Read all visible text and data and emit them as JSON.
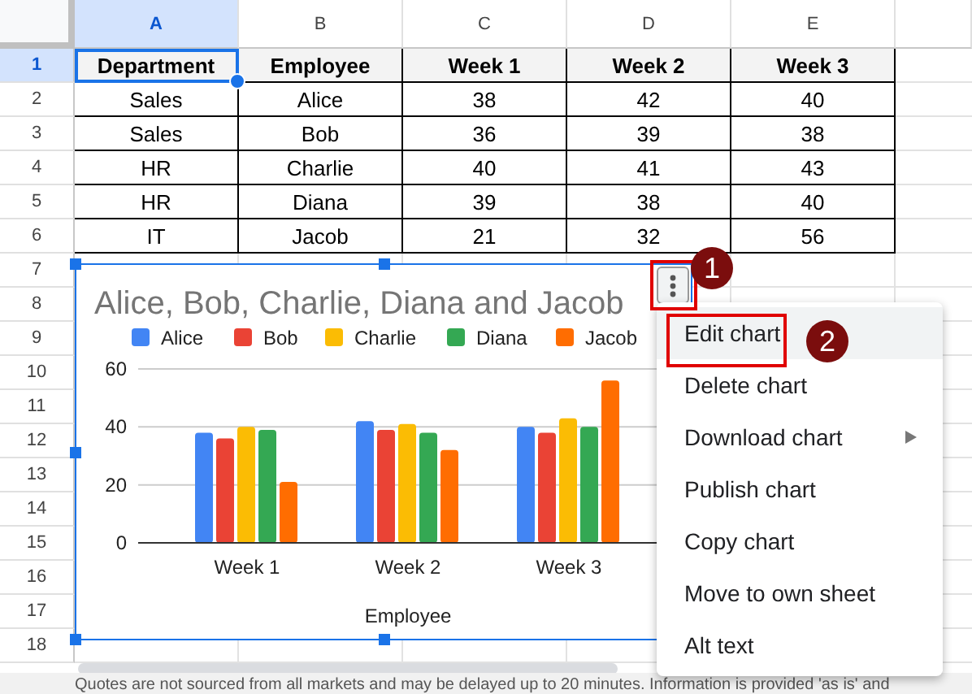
{
  "columns": [
    {
      "label": "A",
      "selected": true
    },
    {
      "label": "B",
      "selected": false
    },
    {
      "label": "C",
      "selected": false
    },
    {
      "label": "D",
      "selected": false
    },
    {
      "label": "E",
      "selected": false
    }
  ],
  "row_numbers": [
    {
      "label": "1",
      "selected": true
    },
    {
      "label": "2",
      "selected": false
    },
    {
      "label": "3",
      "selected": false
    },
    {
      "label": "4",
      "selected": false
    },
    {
      "label": "5",
      "selected": false
    },
    {
      "label": "6",
      "selected": false
    },
    {
      "label": "7",
      "selected": false
    },
    {
      "label": "8",
      "selected": false
    },
    {
      "label": "9",
      "selected": false
    },
    {
      "label": "10",
      "selected": false
    },
    {
      "label": "11",
      "selected": false
    },
    {
      "label": "12",
      "selected": false
    },
    {
      "label": "13",
      "selected": false
    },
    {
      "label": "14",
      "selected": false
    },
    {
      "label": "15",
      "selected": false
    },
    {
      "label": "16",
      "selected": false
    },
    {
      "label": "17",
      "selected": false
    },
    {
      "label": "18",
      "selected": false
    }
  ],
  "table": {
    "header": [
      {
        "label": "Department",
        "selected": true
      },
      {
        "label": "Employee",
        "selected": false
      },
      {
        "label": "Week 1",
        "selected": false
      },
      {
        "label": "Week 2",
        "selected": false
      },
      {
        "label": "Week 3",
        "selected": false
      }
    ],
    "rows": [
      [
        "Sales",
        "Alice",
        "38",
        "42",
        "40"
      ],
      [
        "Sales",
        "Bob",
        "36",
        "39",
        "38"
      ],
      [
        "HR",
        "Charlie",
        "40",
        "41",
        "43"
      ],
      [
        "HR",
        "Diana",
        "39",
        "38",
        "40"
      ],
      [
        "IT",
        "Jacob",
        "21",
        "32",
        "56"
      ]
    ]
  },
  "chart": {
    "chart_data": {
      "type": "bar",
      "legend": true,
      "title": "Alice, Bob, Charlie, Diana and Jacob",
      "xlabel": "Employee",
      "categories": [
        "Week 1",
        "Week 2",
        "Week 3"
      ],
      "ylim": [
        0,
        60
      ],
      "yticks": [
        0,
        20,
        40,
        60
      ],
      "series": [
        {
          "name": "Alice",
          "color": "#4285f4",
          "values": [
            38,
            42,
            40
          ]
        },
        {
          "name": "Bob",
          "color": "#ea4335",
          "values": [
            36,
            39,
            38
          ]
        },
        {
          "name": "Charlie",
          "color": "#fbbc04",
          "values": [
            40,
            41,
            43
          ]
        },
        {
          "name": "Diana",
          "color": "#34a853",
          "values": [
            39,
            38,
            40
          ]
        },
        {
          "name": "Jacob",
          "color": "#ff6d01",
          "values": [
            21,
            32,
            56
          ]
        }
      ]
    }
  },
  "chart_menu": {
    "items": [
      {
        "label": "Edit chart",
        "selected": true,
        "has_submenu": false
      },
      {
        "label": "Delete chart",
        "selected": false,
        "has_submenu": false
      },
      {
        "label": "Download chart",
        "selected": false,
        "has_submenu": true
      },
      {
        "label": "Publish chart",
        "selected": false,
        "has_submenu": false
      },
      {
        "label": "Copy chart",
        "selected": false,
        "has_submenu": false
      },
      {
        "label": "Move to own sheet",
        "selected": false,
        "has_submenu": false
      },
      {
        "label": "Alt text",
        "selected": false,
        "has_submenu": false
      }
    ]
  },
  "callouts": [
    {
      "label": "1"
    },
    {
      "label": "2"
    }
  ],
  "footer": "Quotes are not sourced from all markets and may be delayed up to 20 minutes. Information is provided 'as is' and"
}
